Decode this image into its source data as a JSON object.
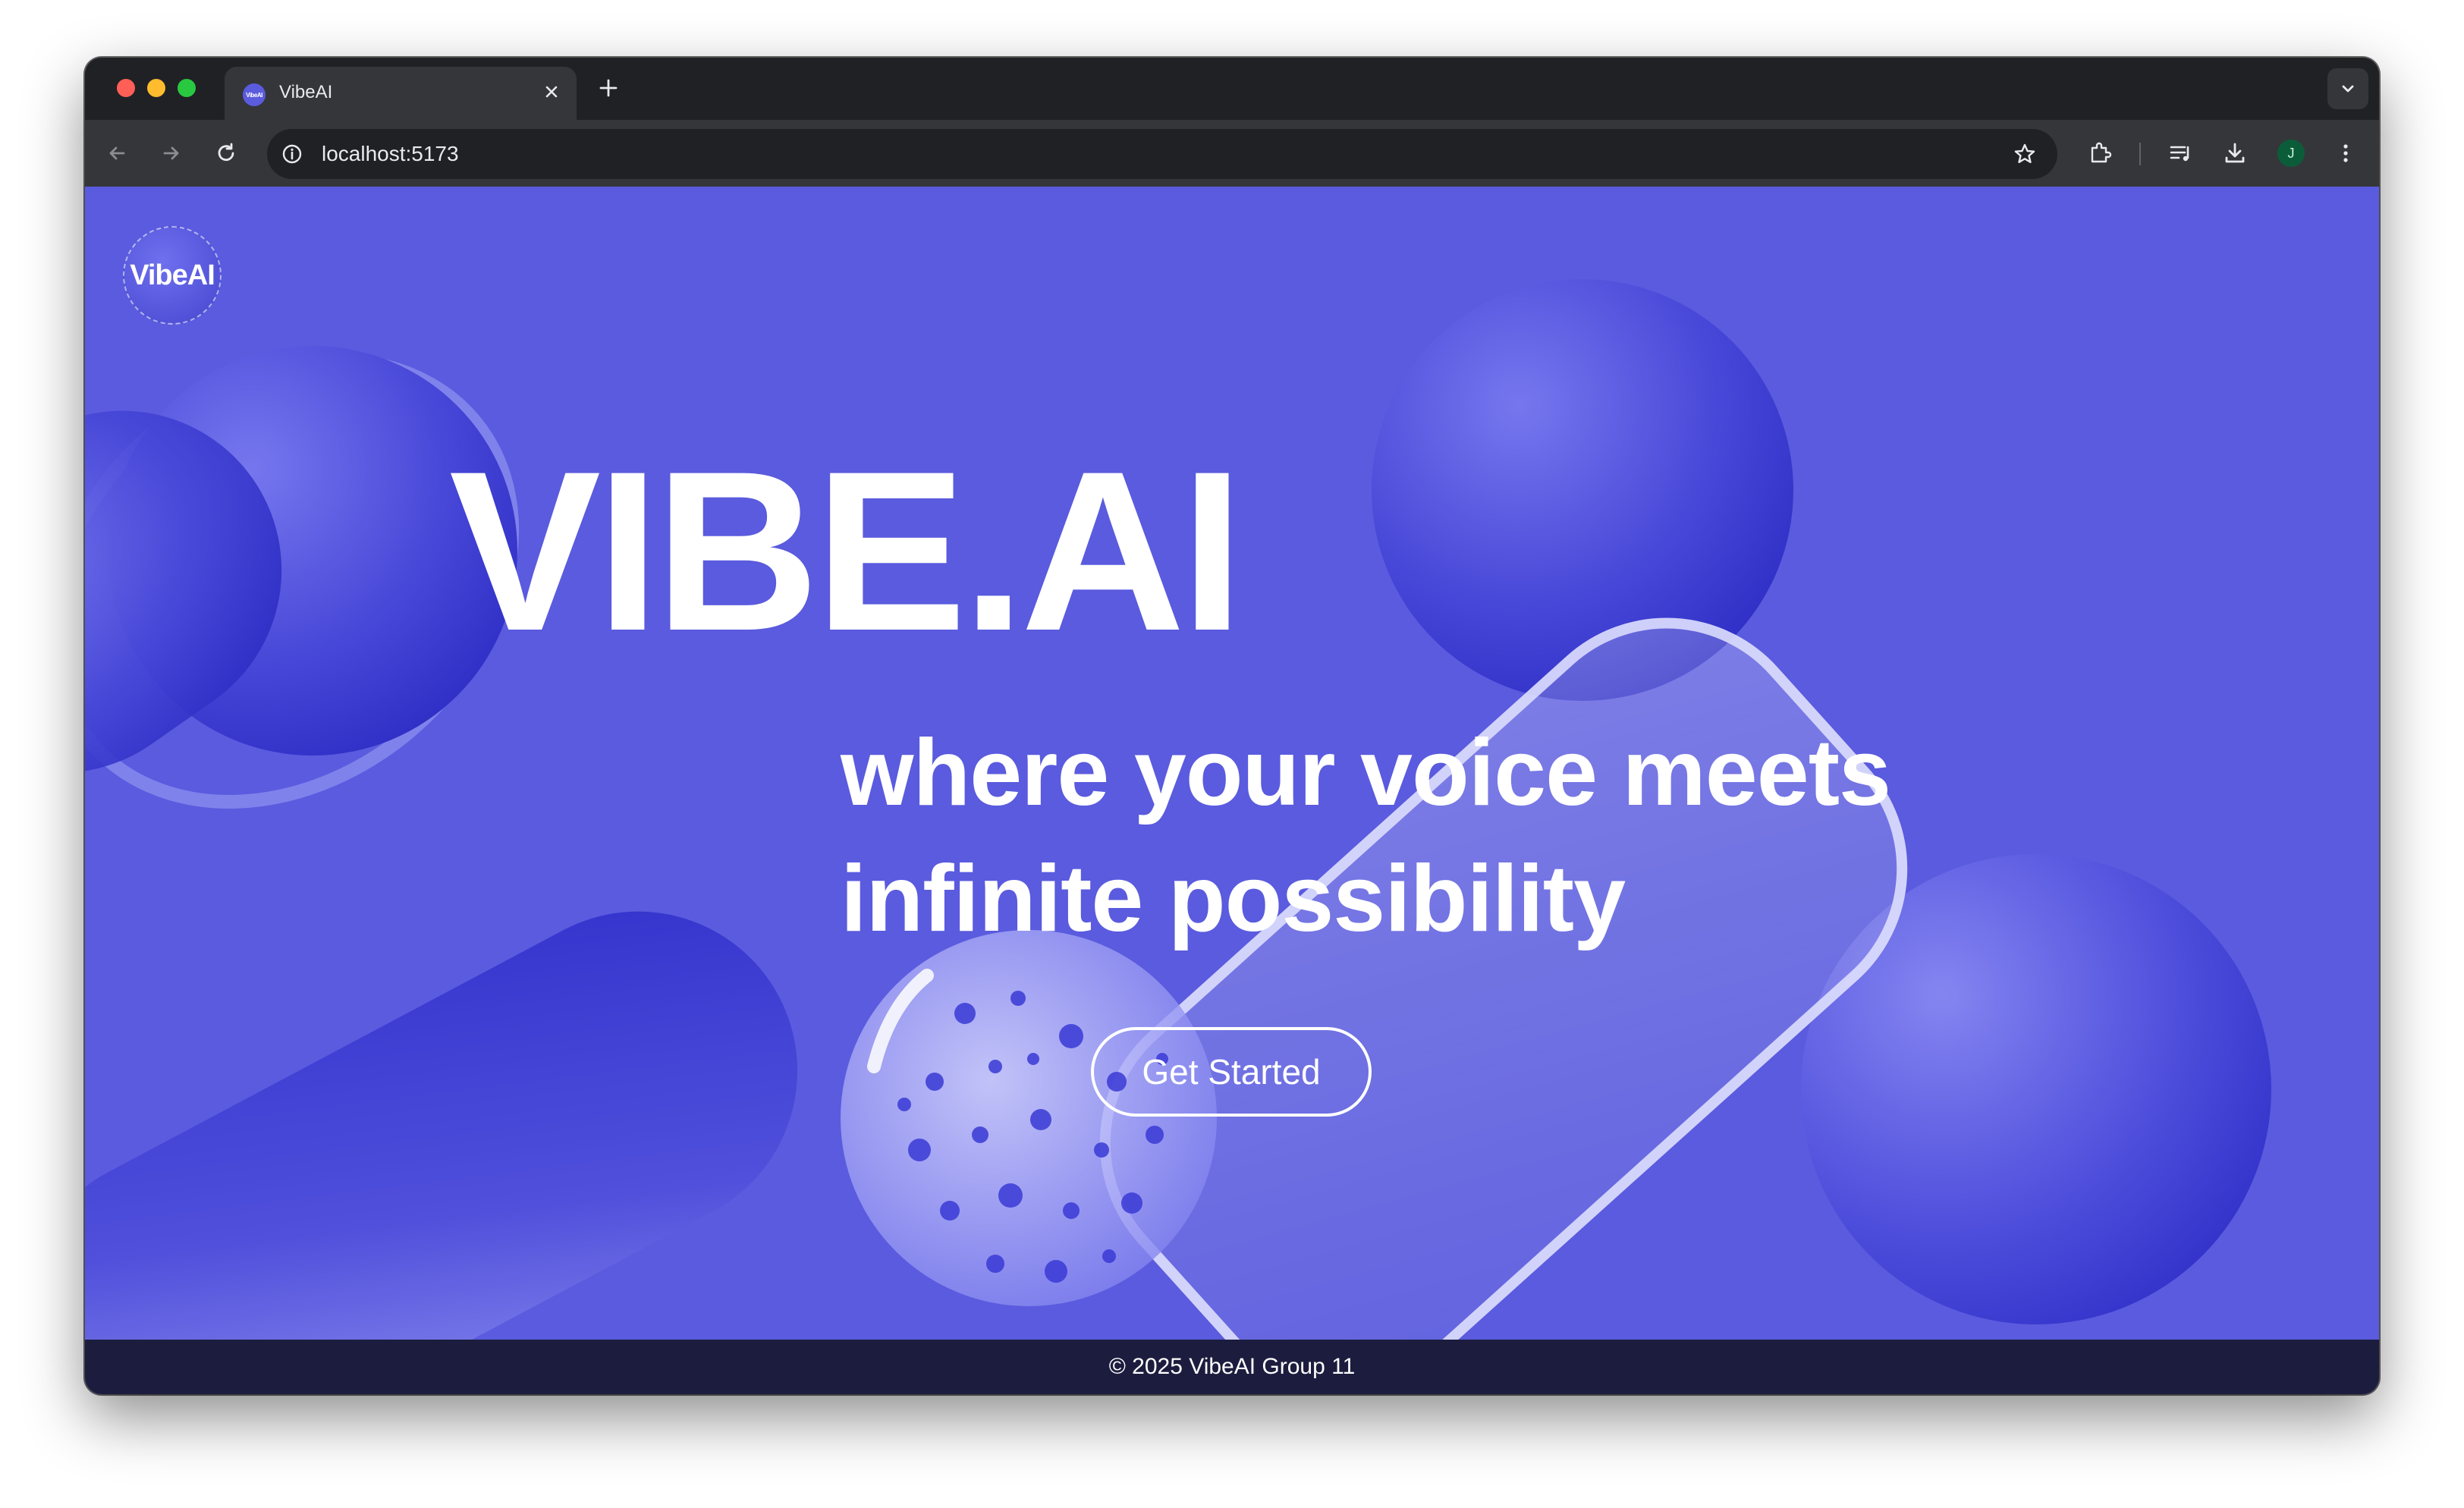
{
  "browser": {
    "tab_title": "VibeAI",
    "tab_favicon_text": "VibeAI",
    "url": "localhost:5173",
    "profile_initial": "J"
  },
  "page": {
    "logo_text": "VibeAI",
    "hero_title": "VIBE.AI",
    "hero_subtitle_line1": "where your voice meets",
    "hero_subtitle_line2": "infinite possibility",
    "cta_label": "Get Started",
    "footer_text": "© 2025 VibeAI Group 11"
  },
  "colors": {
    "page_background": "#5a5bde",
    "footer_background": "#1c1d3e",
    "text": "#ffffff"
  },
  "icons": [
    "back-arrow-icon",
    "forward-arrow-icon",
    "reload-icon",
    "site-info-icon",
    "bookmark-star-icon",
    "extensions-icon",
    "reading-list-icon",
    "download-icon",
    "more-menu-icon",
    "tab-search-icon",
    "close-icon",
    "plus-icon"
  ]
}
